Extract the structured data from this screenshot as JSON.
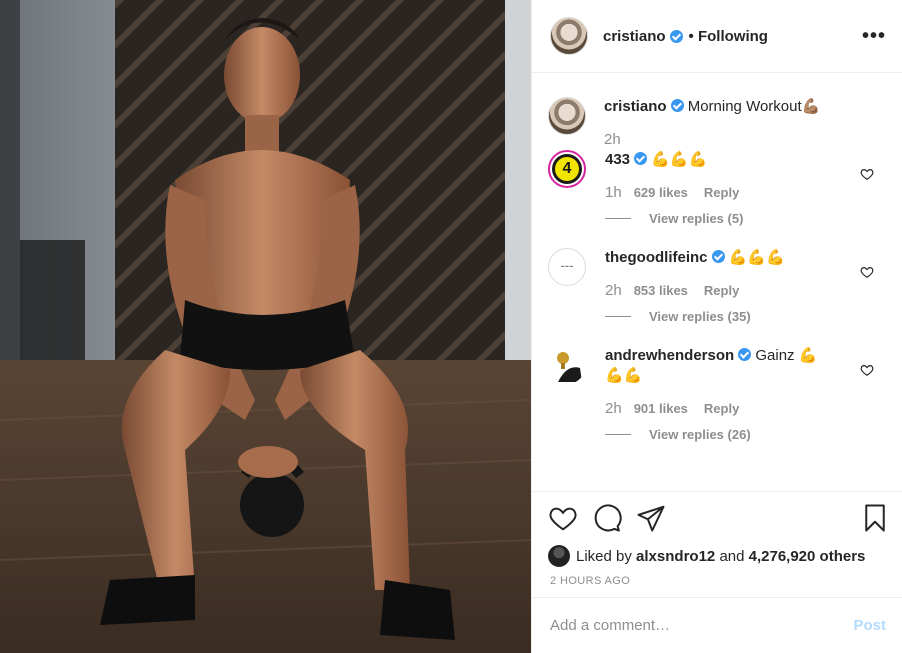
{
  "post": {
    "author": "cristiano",
    "follow_status": "Following",
    "more_icon": "more-dots-icon"
  },
  "caption": {
    "author": "cristiano",
    "text": "Morning Workout",
    "emoji": "💪🏽",
    "time": "2h"
  },
  "comments": [
    {
      "author": "433",
      "text": "",
      "emoji": "💪💪💪",
      "time": "1h",
      "likes": "629 likes",
      "reply": "Reply",
      "view_replies": "View replies (5)",
      "avatar_text": "4"
    },
    {
      "author": "thegoodlifeinc",
      "text": "",
      "emoji": "💪💪💪",
      "time": "2h",
      "likes": "853 likes",
      "reply": "Reply",
      "view_replies": "View replies (35)"
    },
    {
      "author": "andrewhenderson",
      "text": "Gainz",
      "emoji": "💪",
      "emoji2": "💪💪",
      "time": "2h",
      "likes": "901 likes",
      "reply": "Reply",
      "view_replies": "View replies (26)"
    }
  ],
  "liked_by": {
    "prefix": "Liked by",
    "user": "alxsndro12",
    "and": "and",
    "others": "4,276,920 others"
  },
  "timestamp": "2 HOURS AGO",
  "add_comment": {
    "placeholder": "Add a comment…",
    "post_label": "Post"
  },
  "colors": {
    "verified": "#3897f0",
    "post_disabled": "#b3dbff",
    "muted": "#8e8e8e"
  }
}
